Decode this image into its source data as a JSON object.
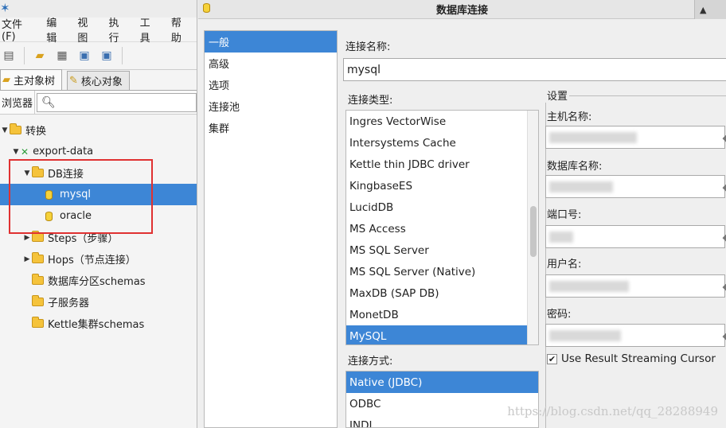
{
  "app": {
    "menu": [
      "文件(F)",
      "编辑",
      "视图",
      "执行",
      "工具",
      "帮助"
    ],
    "tabs": [
      {
        "label": "主对象树"
      },
      {
        "label": "核心对象"
      }
    ],
    "search_label": "浏览器",
    "tree": {
      "root": "转换",
      "transformation": "export-data",
      "db_folder": "DB连接",
      "db_mysql": "mysql",
      "db_oracle": "oracle",
      "steps": "Steps（步骤）",
      "hops": "Hops（节点连接）",
      "partition": "数据库分区schemas",
      "slave": "子服务器",
      "cluster": "Kettle集群schemas"
    }
  },
  "dialog": {
    "title": "数据库连接",
    "nav": [
      "一般",
      "高级",
      "选项",
      "连接池",
      "集群"
    ],
    "connection_name_label": "连接名称:",
    "connection_name_value": "mysql",
    "connection_type_label": "连接类型:",
    "connection_types": [
      "Ingres VectorWise",
      "Intersystems Cache",
      "Kettle thin JDBC driver",
      "KingbaseES",
      "LucidDB",
      "MS Access",
      "MS SQL Server",
      "MS SQL Server (Native)",
      "MaxDB (SAP DB)",
      "MonetDB",
      "MySQL"
    ],
    "selected_connection_type": "MySQL",
    "access_label": "连接方式:",
    "access_methods": [
      "Native (JDBC)",
      "ODBC",
      "JNDI"
    ],
    "settings_legend": "设置",
    "host_label": "主机名称:",
    "dbname_label": "数据库名称:",
    "port_label": "端口号:",
    "user_label": "用户名:",
    "password_label": "密码:",
    "streaming_cursor_label": "Use Result Streaming Cursor",
    "streaming_cursor_checked": true
  },
  "watermark": "https://blog.csdn.net/qq_28288949"
}
